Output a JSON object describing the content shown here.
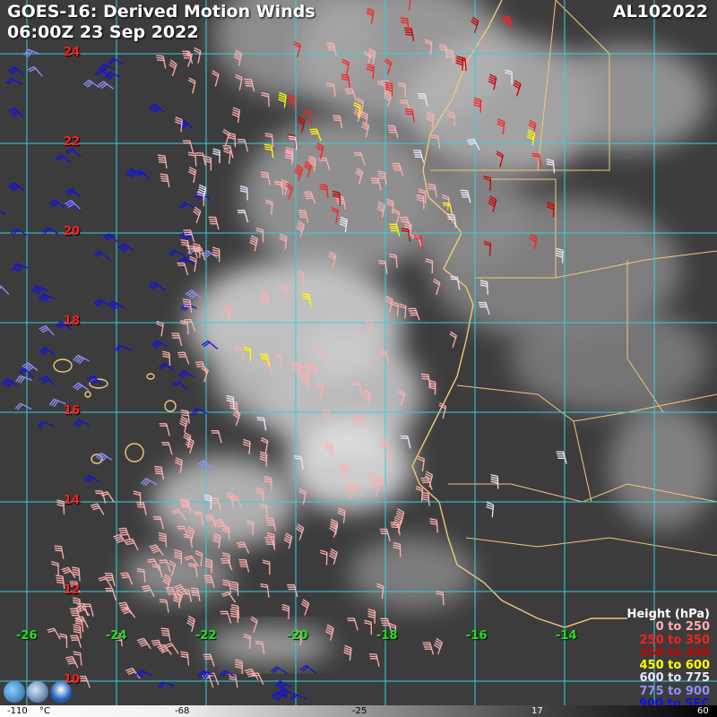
{
  "header": {
    "title_line1": "GOES-16: Derived Motion Winds",
    "title_line2": "06:00Z 23 Sep 2022",
    "storm_id": "AL102022"
  },
  "map": {
    "lat_labels": [
      "24",
      "22",
      "20",
      "18",
      "16",
      "14",
      "12",
      "10"
    ],
    "lon_labels": [
      "-26",
      "-24",
      "-22",
      "-20",
      "-18",
      "-16",
      "-14"
    ],
    "grid_color": "#35d0e0",
    "coast_color": "#f0c878"
  },
  "legend": {
    "title": "Height (hPa)",
    "entries": [
      {
        "label": "0 to 250",
        "color": "#ffb0b0"
      },
      {
        "label": "250 to 350",
        "color": "#ff2020"
      },
      {
        "label": "350 to 450",
        "color": "#c80000"
      },
      {
        "label": "450 to 600",
        "color": "#ffff00"
      },
      {
        "label": "600 to 775",
        "color": "#e8e8ff"
      },
      {
        "label": "775 to 900",
        "color": "#9090ff"
      },
      {
        "label": "900 to SFC",
        "color": "#1010e0"
      }
    ]
  },
  "colorbar": {
    "labels": [
      "-110",
      "°C",
      "-68",
      "-25",
      "17",
      "60"
    ]
  },
  "logos": [
    "cimss-logo",
    "ssec-logo",
    "noaa-logo"
  ]
}
